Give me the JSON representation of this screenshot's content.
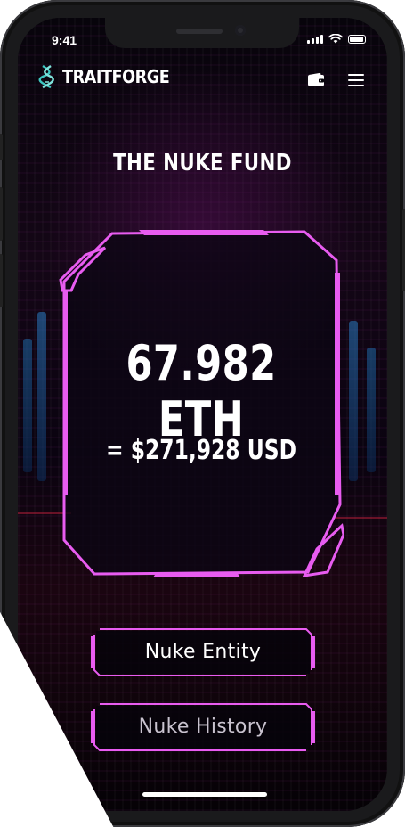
{
  "status_bar": {
    "time": "9:41"
  },
  "header": {
    "logo_text": "TRAITFORGE",
    "wallet_icon": "wallet-icon",
    "menu_icon": "hamburger-menu-icon"
  },
  "page": {
    "title": "THE NUKE FUND"
  },
  "fund": {
    "eth_amount": "67.982 ETH",
    "usd_value": "= $271,928 USD"
  },
  "actions": {
    "nuke_entity_label": "Nuke Entity",
    "nuke_history_label": "Nuke History"
  },
  "colors": {
    "accent": "#e85cf0",
    "accent_dark": "#b22fc0",
    "panel_fill": "#0c0614",
    "background": "#06040a"
  }
}
